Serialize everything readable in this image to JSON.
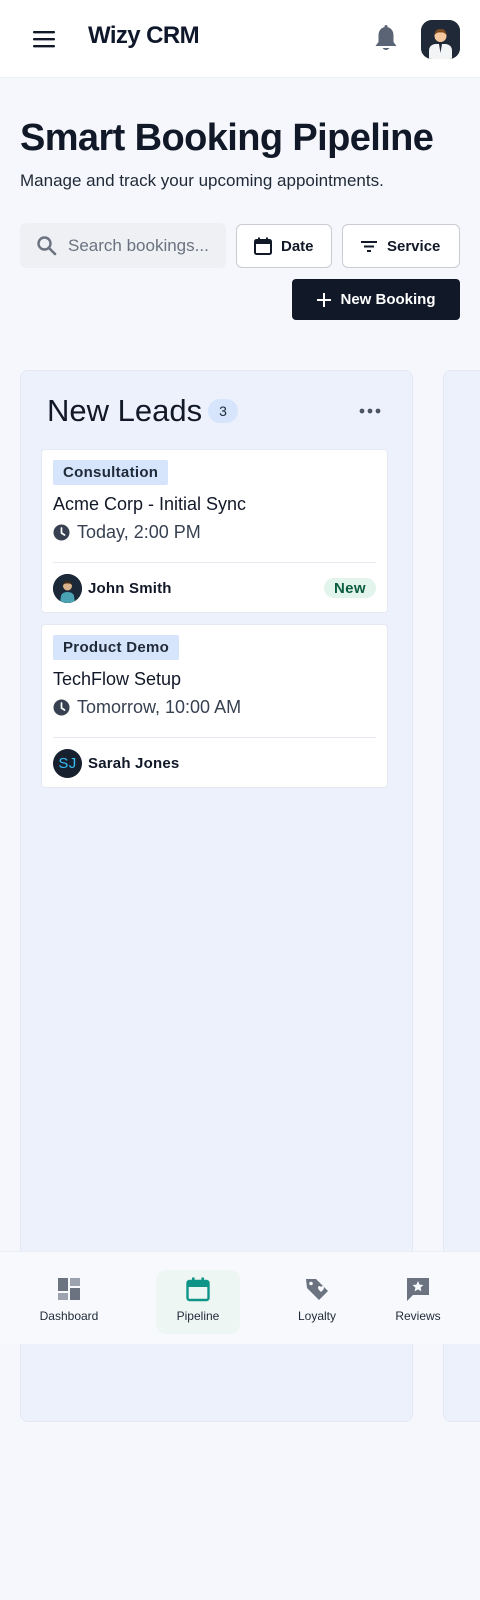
{
  "app": {
    "title": "Wizy CRM"
  },
  "header": {
    "title": "Smart Booking Pipeline",
    "subtitle": "Manage and track your upcoming appointments."
  },
  "controls": {
    "search_placeholder": "Search bookings...",
    "date_label": "Date",
    "service_label": "Service",
    "new_booking_label": "New Booking"
  },
  "icons": {
    "menu": "menu-icon",
    "notifications": "bell-icon",
    "search": "search-icon",
    "date": "calendar-icon",
    "service": "filter-icon",
    "add": "plus-icon",
    "more": "more-horizontal-icon",
    "time": "clock-icon"
  },
  "columns": [
    {
      "title": "New Leads",
      "count": "3",
      "cards": [
        {
          "tag": "Consultation",
          "title": "Acme Corp - Initial Sync",
          "time": "Today, 2:00 PM",
          "assignee": "John Smith",
          "assignee_initials": "",
          "status": "New"
        },
        {
          "tag": "Product Demo",
          "title": "TechFlow Setup",
          "time": "Tomorrow, 10:00 AM",
          "assignee": "Sarah Jones",
          "assignee_initials": "SJ",
          "status": ""
        }
      ]
    }
  ],
  "bottom_nav": {
    "active": "Pipeline",
    "items": [
      {
        "label": "Dashboard",
        "icon": "dashboard-icon"
      },
      {
        "label": "Pipeline",
        "icon": "calendar-icon"
      },
      {
        "label": "Loyalty",
        "icon": "tag-heart-icon"
      },
      {
        "label": "Reviews",
        "icon": "star-message-icon"
      }
    ]
  },
  "colors": {
    "primary": "#111827",
    "accent": "#0f9488",
    "badge_bg": "#d6e5fb",
    "status_new_bg": "#e3f4ec",
    "status_new_text": "#0b5d3f",
    "column_bg": "#edf1fb"
  }
}
